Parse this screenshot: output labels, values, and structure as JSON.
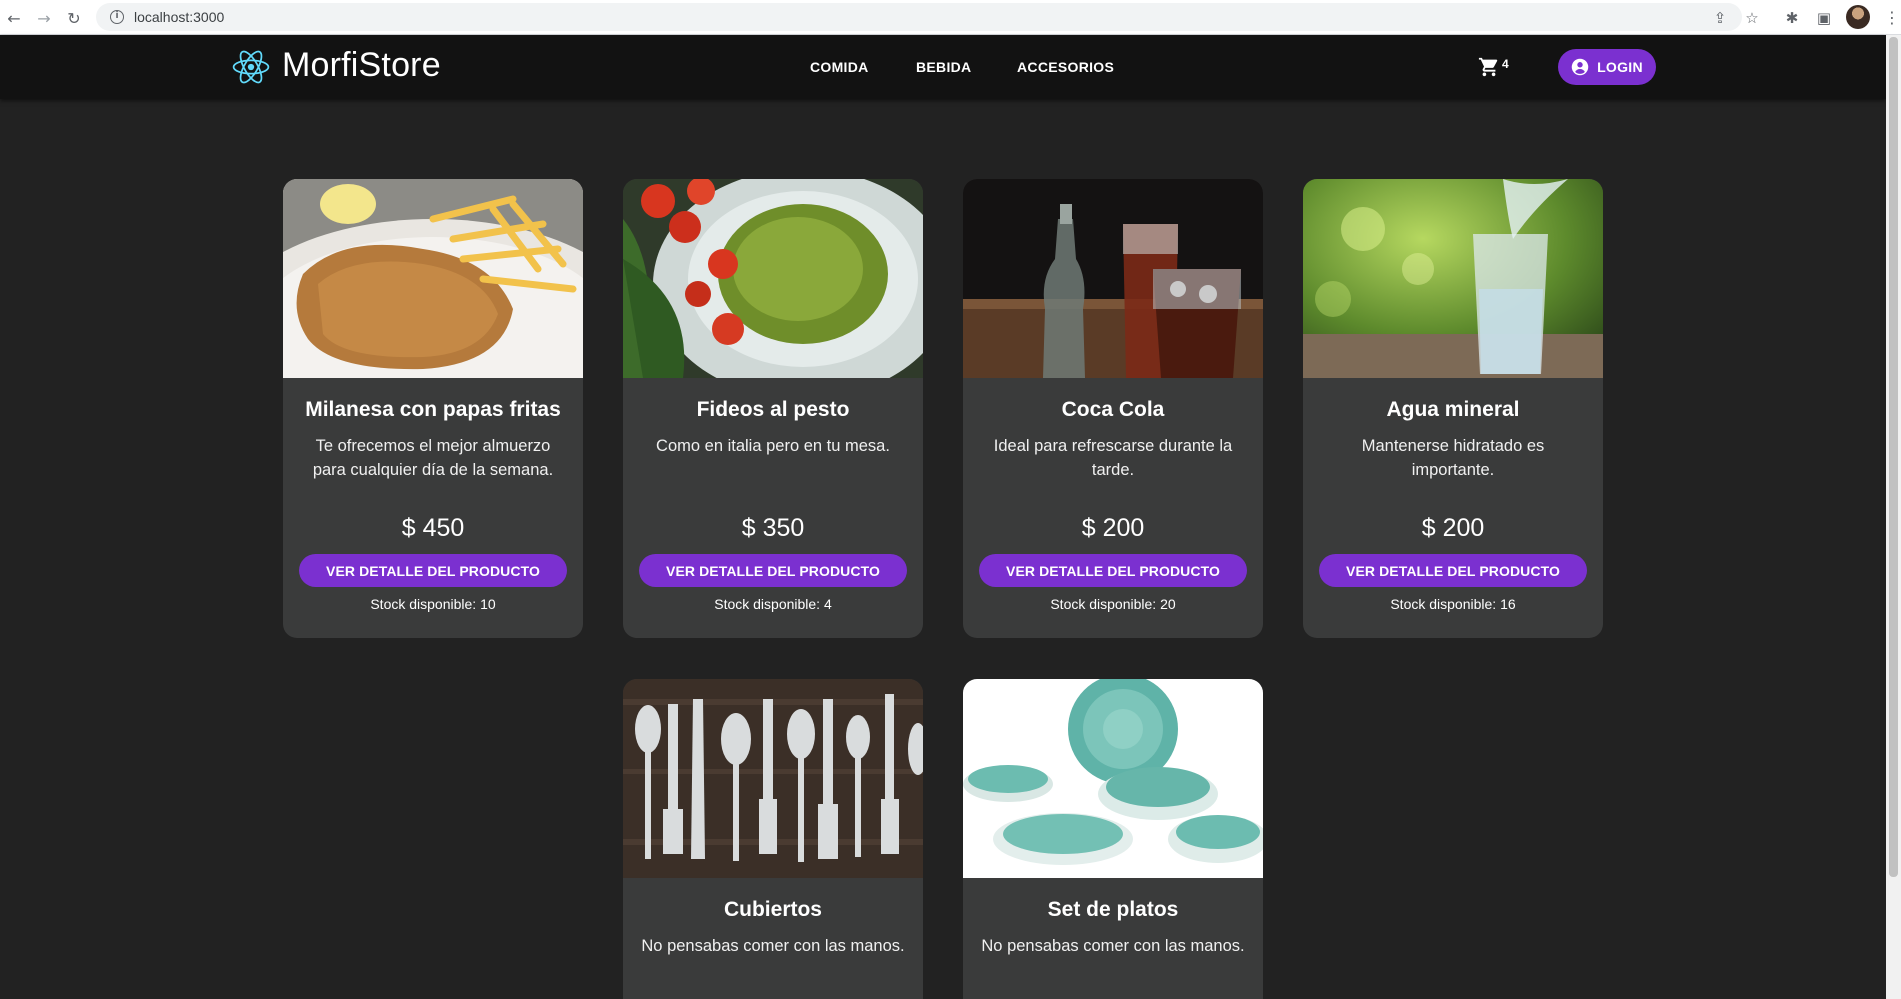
{
  "browser": {
    "url": "localhost:3000"
  },
  "header": {
    "brand": "MorfiStore",
    "nav": [
      "COMIDA",
      "BEBIDA",
      "ACCESORIOS"
    ],
    "cart_count": "4",
    "login_label": "LOGIN"
  },
  "colors": {
    "background": "#222222",
    "header": "#121212",
    "card": "#3a3b3b",
    "accent": "#7b30d0",
    "logo": "#61dafb"
  },
  "products": [
    {
      "title": "Milanesa con papas fritas",
      "description": "Te ofrecemos el mejor almuerzo para cualquier día de la semana.",
      "price": "$ 450",
      "button": "VER DETALLE DEL PRODUCTO",
      "stock": "Stock disponible: 10"
    },
    {
      "title": "Fideos al pesto",
      "description": "Como en italia pero en tu mesa.",
      "price": "$ 350",
      "button": "VER DETALLE DEL PRODUCTO",
      "stock": "Stock disponible: 4"
    },
    {
      "title": "Coca Cola",
      "description": "Ideal para refrescarse durante la tarde.",
      "price": "$ 200",
      "button": "VER DETALLE DEL PRODUCTO",
      "stock": "Stock disponible: 20"
    },
    {
      "title": "Agua mineral",
      "description": "Mantenerse hidratado es importante.",
      "price": "$ 200",
      "button": "VER DETALLE DEL PRODUCTO",
      "stock": "Stock disponible: 16"
    },
    {
      "title": "Cubiertos",
      "description": "No pensabas comer con las manos."
    },
    {
      "title": "Set de platos",
      "description": "No pensabas comer con las manos."
    }
  ]
}
